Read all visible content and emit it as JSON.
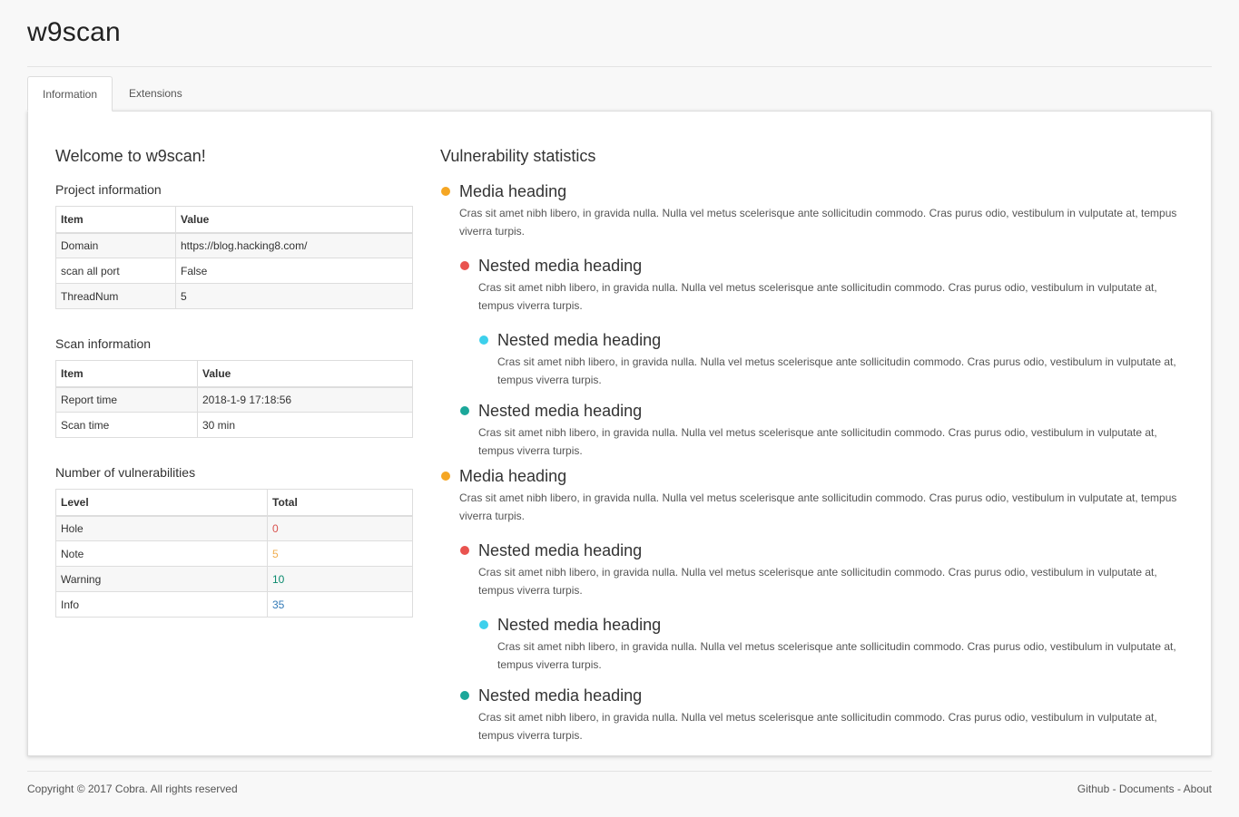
{
  "app": {
    "title": "w9scan"
  },
  "tabs": [
    {
      "label": "Information"
    },
    {
      "label": "Extensions"
    }
  ],
  "info": {
    "welcome": "Welcome to w9scan!",
    "project": {
      "title": "Project information",
      "headers": [
        "Item",
        "Value"
      ],
      "rows": [
        [
          "Domain",
          "https://blog.hacking8.com/"
        ],
        [
          "scan all port",
          "False"
        ],
        [
          "ThreadNum",
          "5"
        ]
      ]
    },
    "scan": {
      "title": "Scan information",
      "headers": [
        "Item",
        "Value"
      ],
      "rows": [
        [
          "Report time",
          "2018-1-9 17:18:56"
        ],
        [
          "Scan time",
          "30 min"
        ]
      ]
    },
    "vulns": {
      "title": "Number of vulnerabilities",
      "headers": [
        "Level",
        "Total"
      ],
      "rows": [
        {
          "level": "Hole",
          "total": "0",
          "color": "#d9534f"
        },
        {
          "level": "Note",
          "total": "5",
          "color": "#f0ad4e"
        },
        {
          "level": "Warning",
          "total": "10",
          "color": "#0b8a6e"
        },
        {
          "level": "Info",
          "total": "35",
          "color": "#337ab7"
        }
      ]
    }
  },
  "stats": {
    "title": "Vulnerability statistics",
    "colors": {
      "orange": "#f5a623",
      "red": "#e9534f",
      "cyan": "#3dd0ec",
      "teal": "#1ba79a"
    },
    "media_heading": "Media heading",
    "nested_heading": "Nested media heading",
    "body": "Cras sit amet nibh libero, in gravida nulla. Nulla vel metus scelerisque ante sollicitudin commodo. Cras purus odio, vestibulum in vulputate at, tempus viverra turpis."
  },
  "footer": {
    "copyright": "Copyright © 2017 Cobra. All rights reserved",
    "links": [
      "Github",
      "Documents",
      "About"
    ],
    "separator": " - "
  }
}
